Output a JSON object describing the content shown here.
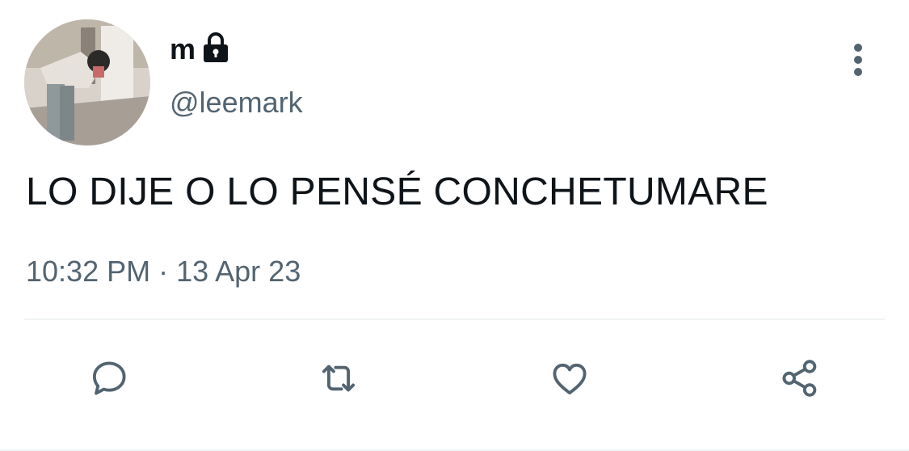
{
  "tweet": {
    "display_name": "m",
    "handle": "@leemark",
    "text": "LO DIJE O LO PENSÉ CONCHETUMARE",
    "time": "10:32 PM",
    "separator": "·",
    "date": "13 Apr 23"
  },
  "icons": {
    "lock": "lock-icon",
    "more": "vertical-ellipsis-icon",
    "reply": "reply-bubble-icon",
    "retweet": "retweet-icon",
    "like": "heart-icon",
    "share": "share-icon"
  },
  "colors": {
    "text_primary": "#0f1419",
    "text_secondary": "#536471",
    "icon": "#536471",
    "divider": "#eff3f4"
  }
}
